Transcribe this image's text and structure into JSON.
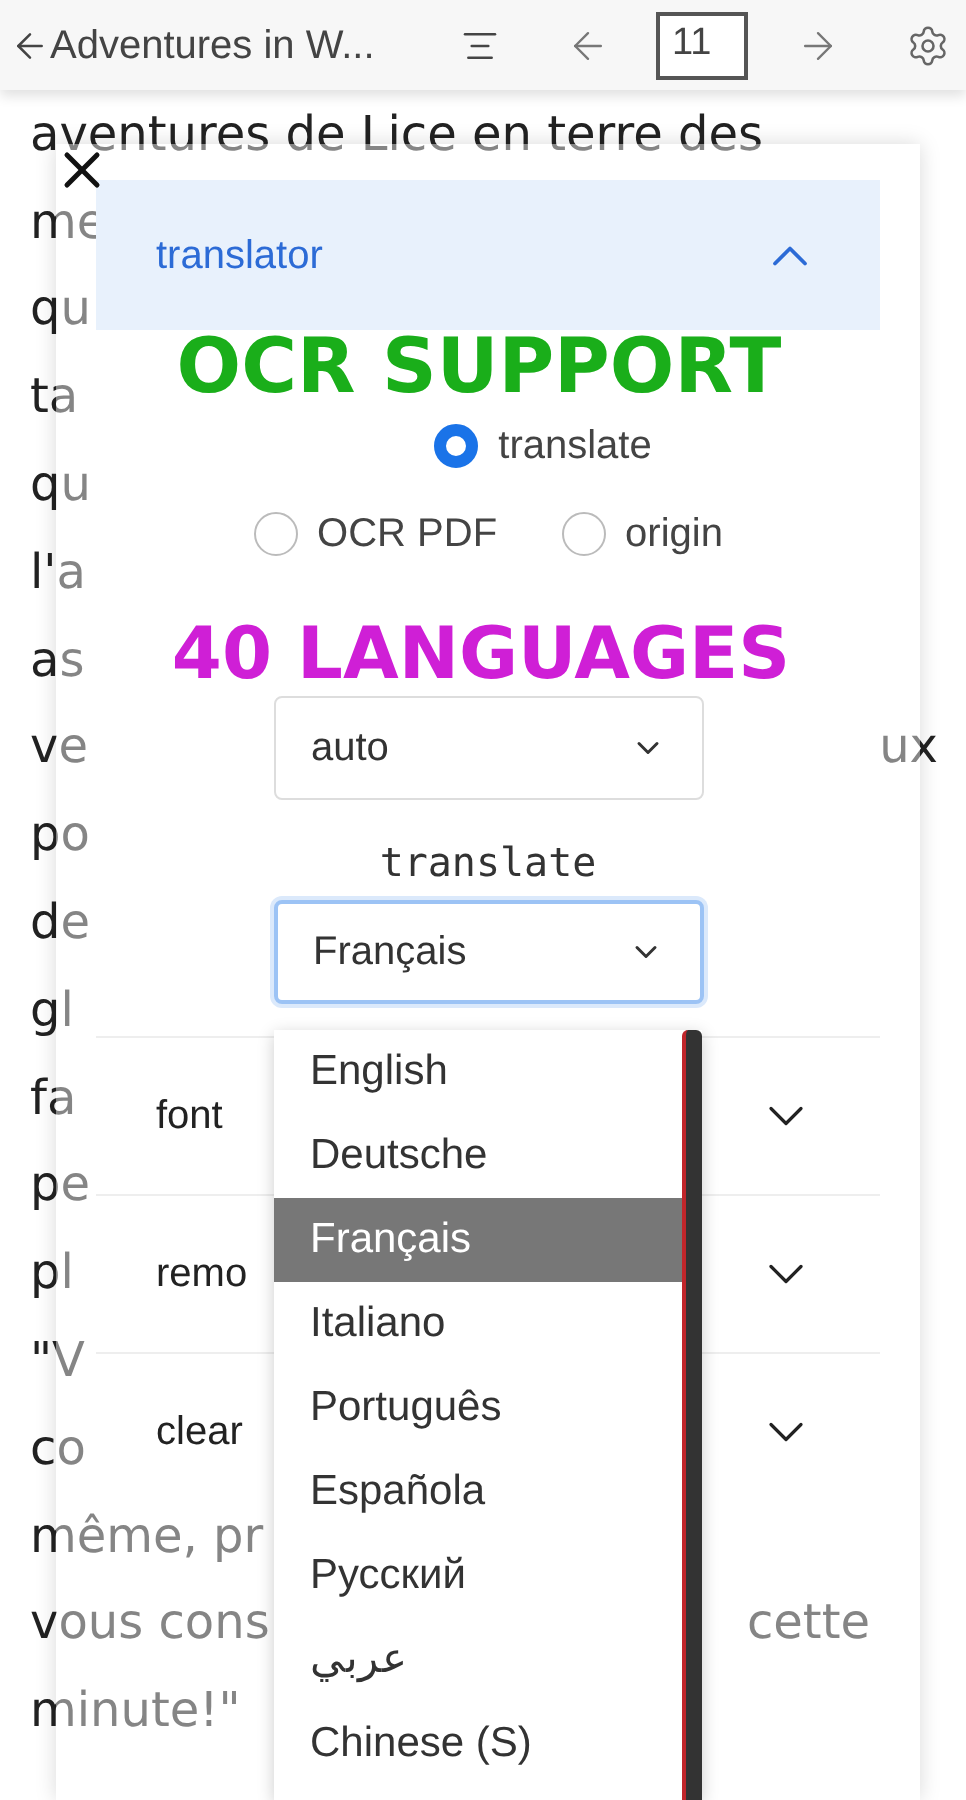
{
  "toolbar": {
    "title": "Adventures in W...",
    "page": "11"
  },
  "book_lines": [
    {
      "text": "aventures de Lice en terre des"
    },
    {
      "text": "me"
    },
    {
      "text": "qu"
    },
    {
      "text": "ta"
    },
    {
      "text": "qu"
    },
    {
      "text": "l'a"
    },
    {
      "text": "as"
    },
    {
      "text": "ve",
      "right": "ux"
    },
    {
      "text": "po"
    },
    {
      "text": "de"
    },
    {
      "text": "gl"
    },
    {
      "text": "fa"
    },
    {
      "text": "pe"
    },
    {
      "text": "pl"
    },
    {
      "text": "\"V"
    },
    {
      "text": "co"
    },
    {
      "text": "même, pr"
    },
    {
      "text": "vous cons",
      "right": "cette"
    },
    {
      "text": "minute!\""
    }
  ],
  "panel": {
    "sections": [
      {
        "label": "translator",
        "expanded": true
      },
      {
        "label": "font",
        "expanded": false
      },
      {
        "label": "remo",
        "expanded": false
      },
      {
        "label": "clear",
        "expanded": false
      }
    ],
    "modes": [
      {
        "label": "translate",
        "selected": true
      },
      {
        "label": "OCR PDF",
        "selected": false
      },
      {
        "label": "origin",
        "selected": false
      }
    ],
    "source_select": {
      "value": "auto"
    },
    "target_label": "translate",
    "target_select": {
      "value": "Français",
      "focused": true
    },
    "options": [
      {
        "label": "English",
        "selected": false
      },
      {
        "label": "Deutsche",
        "selected": false
      },
      {
        "label": "Français",
        "selected": true
      },
      {
        "label": "Italiano",
        "selected": false
      },
      {
        "label": "Português",
        "selected": false
      },
      {
        "label": "Española",
        "selected": false
      },
      {
        "label": "Русский",
        "selected": false
      },
      {
        "label": "عربي",
        "selected": false
      },
      {
        "label": "Chinese (S)",
        "selected": false
      }
    ]
  },
  "captions": [
    {
      "text": "OCR SUPPORT",
      "color": "#1aae1a"
    },
    {
      "text": "40 LANGUAGES",
      "color": "#cf1fd6"
    }
  ]
}
